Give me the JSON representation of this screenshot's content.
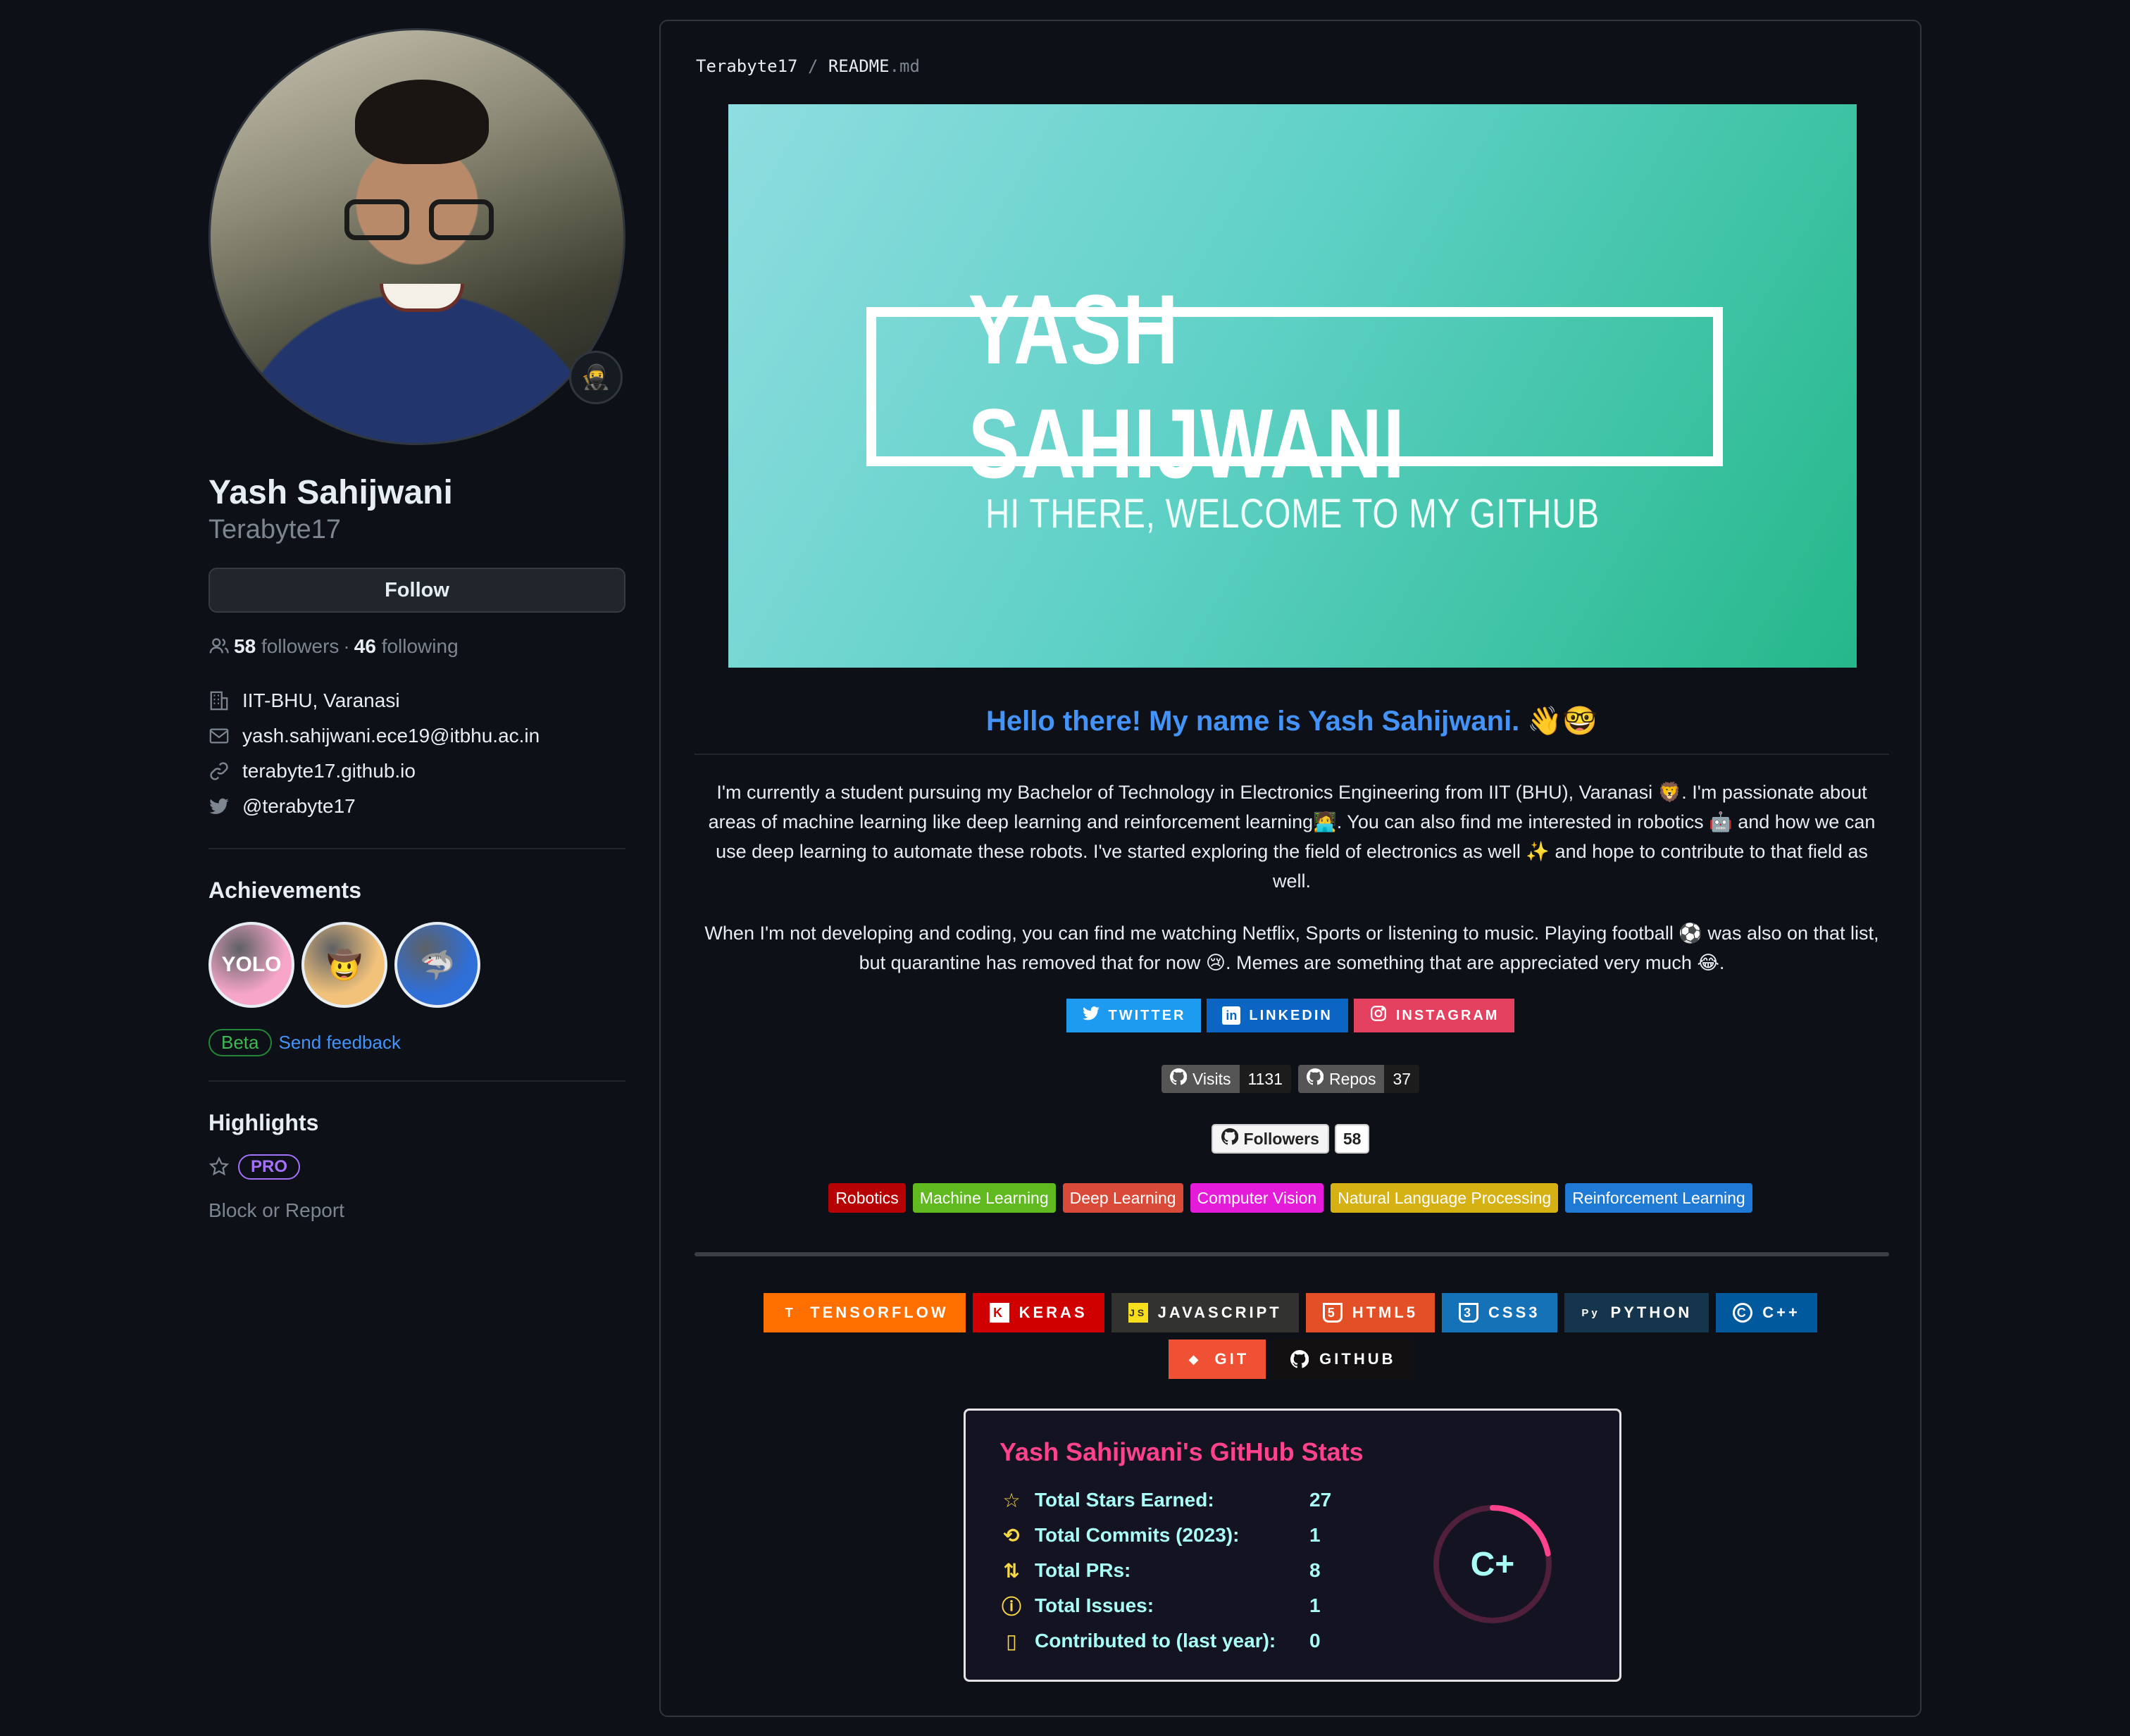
{
  "profile": {
    "fullname": "Yash Sahijwani",
    "username": "Terabyte17",
    "follow_label": "Follow",
    "followers_count": "58",
    "followers_label": "followers",
    "separator": "·",
    "following_count": "46",
    "following_label": "following",
    "organization": "IIT-BHU, Varanasi",
    "email": "yash.sahijwani.ece19@itbhu.ac.in",
    "website": "terabyte17.github.io",
    "twitter": "@terabyte17",
    "status_emoji": "🥷"
  },
  "achievements": {
    "heading": "Achievements",
    "badges": [
      {
        "name": "yolo",
        "glyph": "YOLO",
        "color": "#f7a6c9"
      },
      {
        "name": "starstruck",
        "glyph": "🤠",
        "color": "#f2c27b"
      },
      {
        "name": "pull-shark",
        "glyph": "🦈",
        "color": "#2f6fd8"
      }
    ],
    "beta_label": "Beta",
    "feedback_label": "Send feedback"
  },
  "highlights": {
    "heading": "Highlights",
    "pro_label": "PRO",
    "block_label": "Block or Report"
  },
  "readme": {
    "path_user": "Terabyte17",
    "path_sep": "/",
    "path_file": "README",
    "path_ext": ".md",
    "banner_title": "YASH SAHIJWANI",
    "banner_subtitle": "HI THERE, WELCOME TO MY GITHUB",
    "hello": "Hello there! My name is Yash Sahijwani. 👋🤓",
    "para1": "I'm currently a student pursuing my Bachelor of Technology in Electronics Engineering from IIT (BHU), Varanasi 🦁. I'm passionate about areas of machine learning like deep learning and reinforcement learning🧑‍💻. You can also find me interested in robotics 🤖 and how we can use deep learning to automate these robots. I've started exploring the field of electronics as well ✨ and hope to contribute to that field as well.",
    "para2": "When I'm not developing and coding, you can find me watching Netflix, Sports or listening to music. Playing football ⚽ was also on that list, but quarantine has removed that for now 😢. Memes are something that are appreciated very much 😂.",
    "socials": [
      {
        "label": "TWITTER",
        "icon": "twitter-icon",
        "glyph": "🐦",
        "color": "#1d9bf0"
      },
      {
        "label": "LINKEDIN",
        "icon": "linkedin-icon",
        "glyph": "in",
        "color": "#0a66c2"
      },
      {
        "label": "INSTAGRAM",
        "icon": "instagram-icon",
        "glyph": "◎",
        "color": "#e4405f"
      }
    ],
    "counters": [
      {
        "label": "Visits",
        "value": "1131"
      },
      {
        "label": "Repos",
        "value": "37"
      }
    ],
    "followers_badge": {
      "label": "Followers",
      "value": "58"
    },
    "topics": [
      {
        "label": "Robotics",
        "color": "#b60205"
      },
      {
        "label": "Machine Learning",
        "color": "#5fb91f"
      },
      {
        "label": "Deep Learning",
        "color": "#d94a38"
      },
      {
        "label": "Computer Vision",
        "color": "#e41bd9"
      },
      {
        "label": "Natural Language Processing",
        "color": "#d6b114"
      },
      {
        "label": "Reinforcement Learning",
        "color": "#1f7ad6"
      }
    ],
    "tech": [
      {
        "label": "TENSORFLOW",
        "icon": "tensorflow-icon",
        "glyph": "T",
        "color": "#ff6f00"
      },
      {
        "label": "KERAS",
        "icon": "keras-icon",
        "glyph": "K",
        "color": "#d00000"
      },
      {
        "label": "JAVASCRIPT",
        "icon": "javascript-icon",
        "glyph": "JS",
        "color": "#323330"
      },
      {
        "label": "HTML5",
        "icon": "html5-icon",
        "glyph": "5",
        "color": "#e34f26"
      },
      {
        "label": "CSS3",
        "icon": "css3-icon",
        "glyph": "3",
        "color": "#1572b6"
      },
      {
        "label": "PYTHON",
        "icon": "python-icon",
        "glyph": "Py",
        "color": "#14354c"
      },
      {
        "label": "C++",
        "icon": "cpp-icon",
        "glyph": "C",
        "color": "#00599c"
      },
      {
        "label": "GIT",
        "icon": "git-icon",
        "glyph": "◆",
        "color": "#f05033"
      },
      {
        "label": "GITHUB",
        "icon": "github-icon",
        "glyph": "◉",
        "color": "#121011"
      }
    ]
  },
  "stats": {
    "title": "Yash Sahijwani's GitHub Stats",
    "rows": [
      {
        "label": "Total Stars Earned:",
        "value": "27",
        "icon": "star-icon",
        "glyph": "☆"
      },
      {
        "label": "Total Commits (2023):",
        "value": "1",
        "icon": "history-icon",
        "glyph": "⟲"
      },
      {
        "label": "Total PRs:",
        "value": "8",
        "icon": "pull-request-icon",
        "glyph": "⇅"
      },
      {
        "label": "Total Issues:",
        "value": "1",
        "icon": "issue-icon",
        "glyph": "ⓘ"
      },
      {
        "label": "Contributed to (last year):",
        "value": "0",
        "icon": "repo-icon",
        "glyph": "▯"
      }
    ],
    "rank": "C+",
    "rank_progress": 0.22
  },
  "colors": {
    "bg": "#0d1117",
    "link": "#4493f8",
    "stats_title": "#fe428e",
    "stats_text": "#a9fef7",
    "stats_icon": "#f8d847"
  }
}
